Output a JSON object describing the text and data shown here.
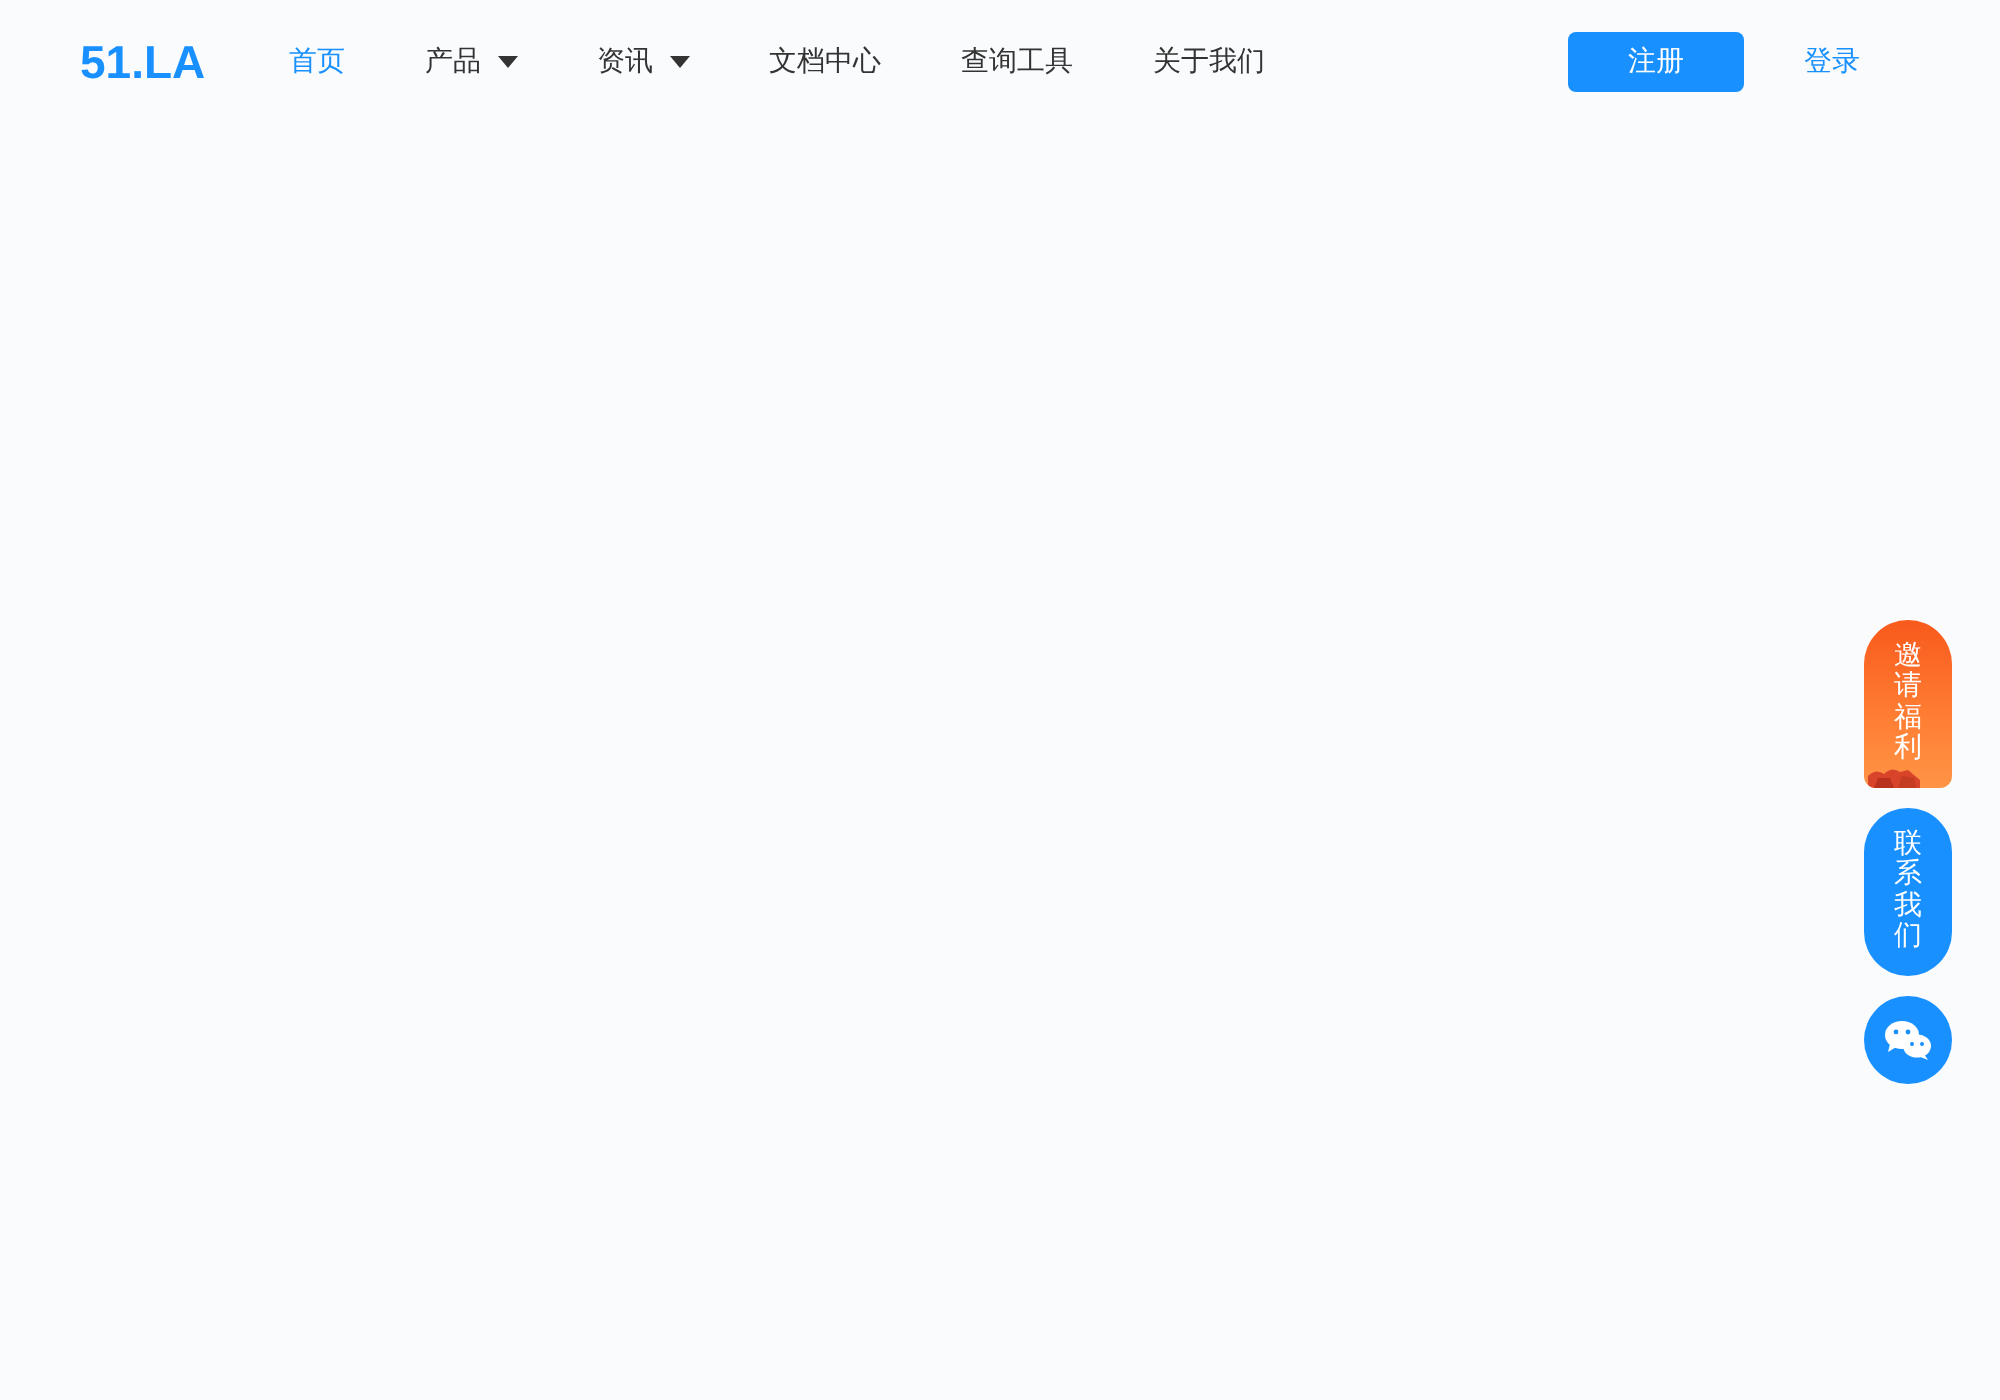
{
  "header": {
    "logo": "51.LA",
    "nav": [
      {
        "label": "首页",
        "selected": true,
        "has_dropdown": false
      },
      {
        "label": "产品",
        "selected": false,
        "has_dropdown": true
      },
      {
        "label": "资讯",
        "selected": false,
        "has_dropdown": true
      },
      {
        "label": "文档中心",
        "selected": false,
        "has_dropdown": false
      },
      {
        "label": "查询工具",
        "selected": false,
        "has_dropdown": false
      },
      {
        "label": "关于我们",
        "selected": false,
        "has_dropdown": false
      }
    ],
    "register_button": "注册",
    "login_link": "登录"
  },
  "floating_actions": [
    {
      "kind": "invite",
      "label": "邀请福利"
    },
    {
      "kind": "contact",
      "label": "联系我们"
    },
    {
      "kind": "wechat"
    }
  ]
}
